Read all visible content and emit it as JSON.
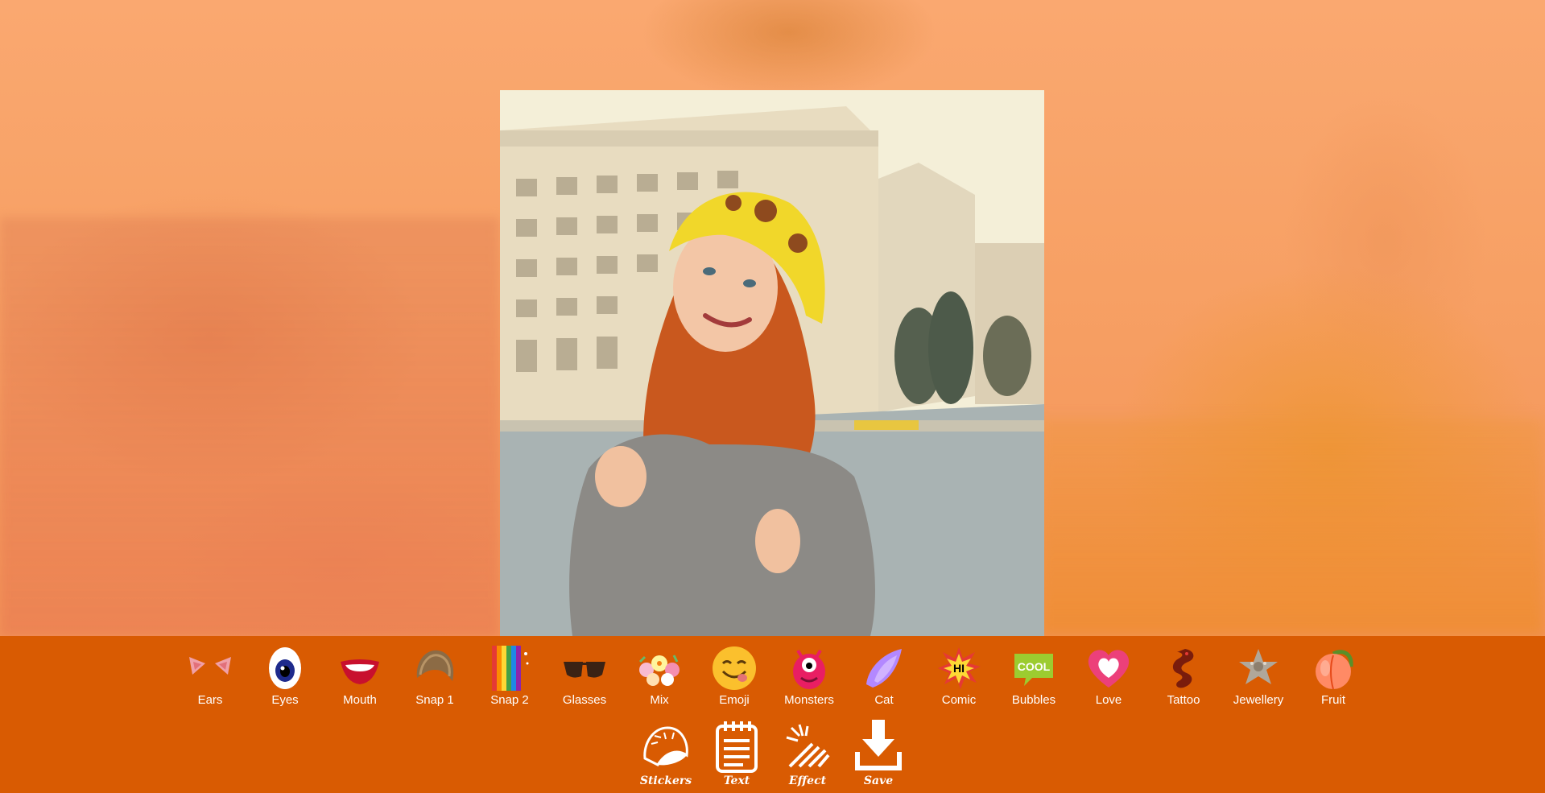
{
  "categories": [
    {
      "label": "Ears",
      "icon": "cat-ears-icon"
    },
    {
      "label": "Eyes",
      "icon": "eye-icon"
    },
    {
      "label": "Mouth",
      "icon": "mouth-icon"
    },
    {
      "label": "Snap 1",
      "icon": "hair-icon"
    },
    {
      "label": "Snap 2",
      "icon": "rainbow-icon"
    },
    {
      "label": "Glasses",
      "icon": "sunglasses-icon"
    },
    {
      "label": "Mix",
      "icon": "flower-crown-icon"
    },
    {
      "label": "Emoji",
      "icon": "smiley-icon"
    },
    {
      "label": "Monsters",
      "icon": "monster-icon"
    },
    {
      "label": "Cat",
      "icon": "cat-ear-icon"
    },
    {
      "label": "Comic",
      "icon": "comic-burst-icon"
    },
    {
      "label": "Bubbles",
      "icon": "speech-bubble-icon"
    },
    {
      "label": "Love",
      "icon": "heart-icon"
    },
    {
      "label": "Tattoo",
      "icon": "dragon-icon"
    },
    {
      "label": "Jewellery",
      "icon": "brooch-icon"
    },
    {
      "label": "Fruit",
      "icon": "peach-icon"
    }
  ],
  "actions": [
    {
      "label": "Stickers",
      "icon": "sticker-icon"
    },
    {
      "label": "Text",
      "icon": "notepad-icon"
    },
    {
      "label": "Effect",
      "icon": "sparkle-wand-icon"
    },
    {
      "label": "Save",
      "icon": "download-icon"
    }
  ],
  "comic_text": "HI",
  "bubble_text": "COOL",
  "colors": {
    "toolbar": "#d95b02",
    "background": "#f9a366"
  }
}
